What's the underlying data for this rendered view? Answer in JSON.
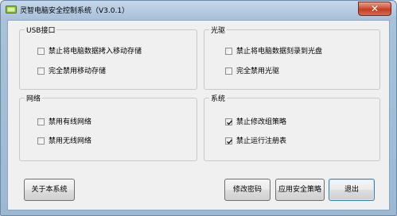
{
  "window": {
    "title": "灵智电脑安全控制系统（V3.0.1）",
    "close_glyph": "✕"
  },
  "groups": {
    "usb": {
      "title": "USB接口",
      "items": [
        {
          "label": "禁止将电脑数据拷入移动存储",
          "checked": false
        },
        {
          "label": "完全禁用移动存储",
          "checked": false
        }
      ]
    },
    "optical": {
      "title": "光驱",
      "items": [
        {
          "label": "禁止将电脑数据刻录到光盘",
          "checked": false
        },
        {
          "label": "完全禁用光驱",
          "checked": false
        }
      ]
    },
    "network": {
      "title": "网络",
      "items": [
        {
          "label": "禁用有线网络",
          "checked": false
        },
        {
          "label": "禁用无线网络",
          "checked": false
        }
      ]
    },
    "system": {
      "title": "系统",
      "items": [
        {
          "label": "禁止修改组策略",
          "checked": true
        },
        {
          "label": "禁止运行注册表",
          "checked": true
        }
      ]
    }
  },
  "buttons": {
    "about": "关于本系统",
    "change_password": "修改密码",
    "apply_policy": "应用安全策略",
    "exit": "退出"
  }
}
